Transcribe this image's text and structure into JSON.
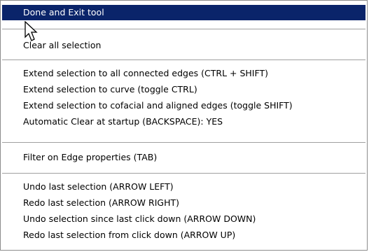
{
  "menu": {
    "items": [
      {
        "label": "Done and Exit tool"
      },
      {
        "label": "Clear all selection"
      },
      {
        "label": "Extend selection to all connected edges (CTRL + SHIFT)"
      },
      {
        "label": "Extend selection to curve (toggle CTRL)"
      },
      {
        "label": "Extend selection to cofacial and aligned edges (toggle SHIFT)"
      },
      {
        "label": "Automatic Clear at startup (BACKSPACE): YES"
      },
      {
        "label": "Filter on Edge properties (TAB)"
      },
      {
        "label": "Undo last selection (ARROW LEFT)"
      },
      {
        "label": "Redo last selection (ARROW RIGHT)"
      },
      {
        "label": "Undo selection since last click down (ARROW DOWN)"
      },
      {
        "label": "Redo last selection from click down (ARROW UP)"
      }
    ]
  },
  "colors": {
    "highlight_bg": "#0a246a",
    "highlight_text": "#ffffff",
    "separator": "#a0a0a0"
  },
  "icons": {
    "cursor": "arrow-pointer-icon"
  }
}
